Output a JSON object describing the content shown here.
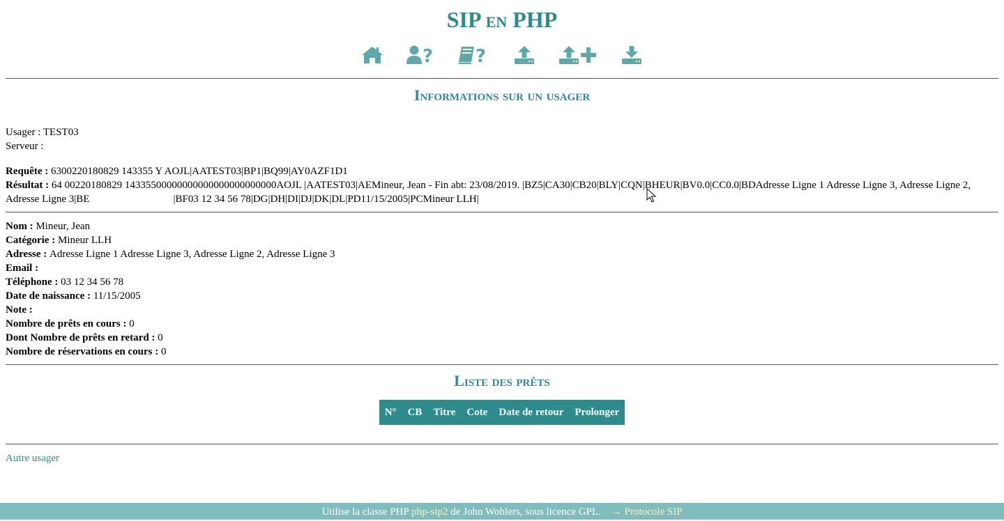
{
  "site": {
    "title": "SIP en PHP"
  },
  "nav": {
    "icons": [
      {
        "name": "home-icon"
      },
      {
        "name": "user-query-icon"
      },
      {
        "name": "book-query-icon"
      },
      {
        "name": "checkout-icon"
      },
      {
        "name": "renew-icon"
      },
      {
        "name": "checkin-icon"
      }
    ]
  },
  "info": {
    "heading": "Informations sur un usager",
    "usager_label": "Usager : ",
    "usager_value": "TEST03",
    "serveur_label": "Serveur : ",
    "serveur_value": "",
    "requete_label": "Requête : ",
    "requete_value": "6300220180829 143355 Y AOJL|AATEST03|BP1|BQ99|AY0AZF1D1",
    "resultat_label": "Résultat : ",
    "resultat_part1": "64 00220180829 14335500000000000000000000000AOJL |AATEST03|AEMineur, Jean - Fin abt: 23/08/2019. |BZ5|CA30|CB20|BLY|CQN|BHEUR|BV0.0|CC0.0|BDAdresse Ligne 1 Adresse Ligne 3, Adresse Ligne 2, Adresse Ligne 3|BE",
    "resultat_part2": "|BF03 12 34 56 78|DG|DH|DI|DJ|DK|DL|PD11/15/2005|PCMineur LLH|"
  },
  "details": {
    "nom_label": "Nom : ",
    "nom_value": "Mineur, Jean",
    "categorie_label": "Catégorie : ",
    "categorie_value": "Mineur LLH",
    "adresse_label": "Adresse : ",
    "adresse_value": "Adresse Ligne 1 Adresse Ligne 3, Adresse Ligne 2, Adresse Ligne 3",
    "email_label": "Email : ",
    "email_value": "",
    "telephone_label": "Téléphone : ",
    "telephone_value": "03 12 34 56 78",
    "naissance_label": "Date de naissance : ",
    "naissance_value": "11/15/2005",
    "note_label": "Note : ",
    "note_value": "",
    "prets_label": "Nombre de prêts en cours : ",
    "prets_value": "0",
    "retard_label": "Dont Nombre de prêts en retard : ",
    "retard_value": "0",
    "reservations_label": "Nombre de réservations en cours : ",
    "reservations_value": "0"
  },
  "loans": {
    "heading": "Liste des prêts",
    "columns": [
      "N°",
      "CB",
      "Titre",
      "Cote",
      "Date de retour",
      "Prolonger"
    ]
  },
  "links": {
    "other_user": "Autre usager"
  },
  "footer": {
    "text_before": "Utilise la classe PHP ",
    "lib_link": "php-sip2",
    "text_after": " de John Wohlers, sous licence GPL.",
    "protocol_link": "→ Protocole SIP"
  }
}
